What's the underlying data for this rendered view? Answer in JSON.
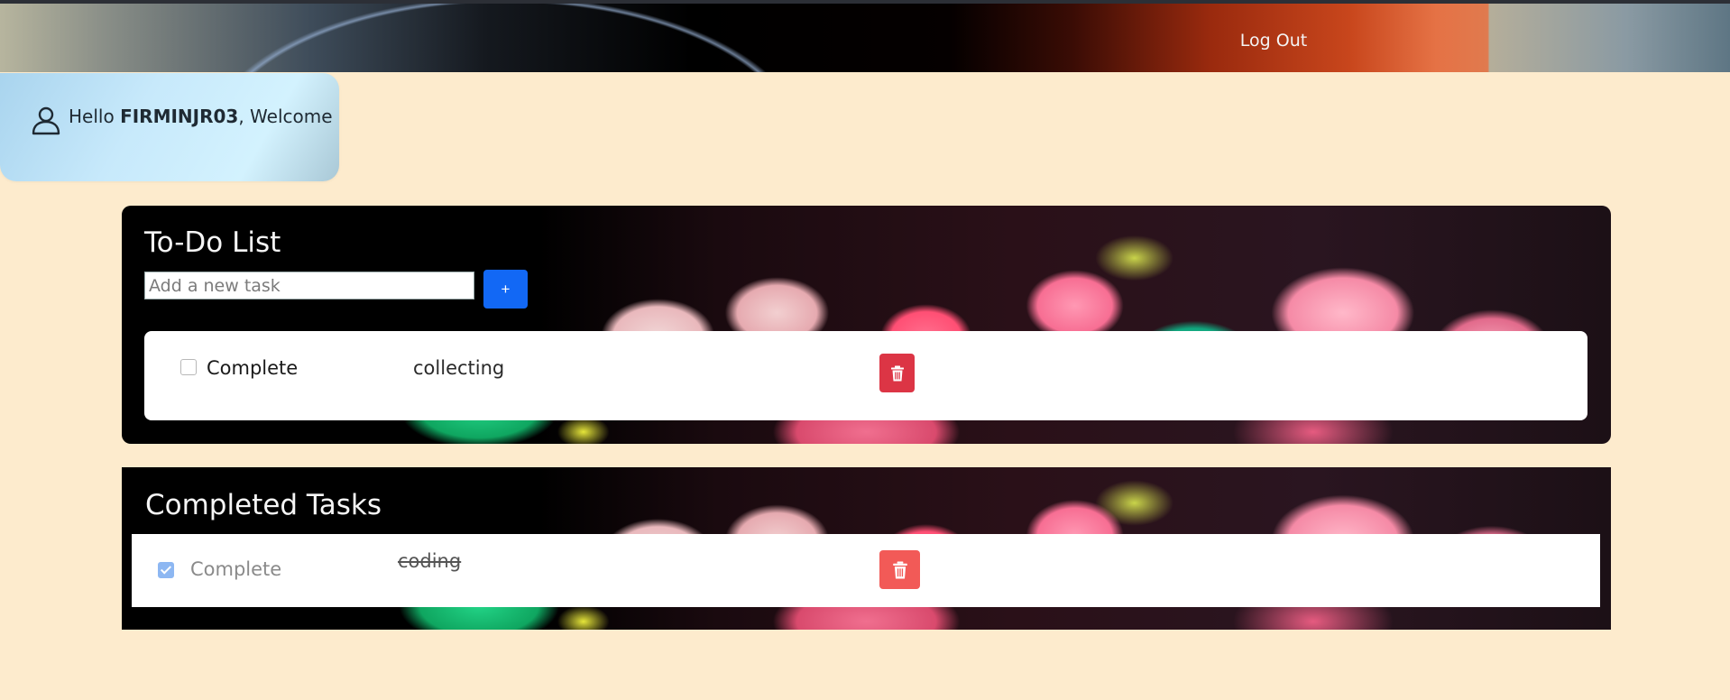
{
  "header": {
    "logout_label": "Log Out"
  },
  "welcome": {
    "hello": "Hello ",
    "username": "FIRMINJR03",
    "suffix": ", Welcome"
  },
  "todo": {
    "title": "To-Do List",
    "input_placeholder": "Add a new task",
    "add_label": "+",
    "tasks": [
      {
        "complete_label": "Complete",
        "text": "collecting",
        "checked": false
      }
    ]
  },
  "completed": {
    "title": "Completed Tasks",
    "tasks": [
      {
        "complete_label": "Complete",
        "text": "coding",
        "checked": true
      }
    ]
  },
  "colors": {
    "page_bg": "#fdebcd",
    "add_button": "#1268f5",
    "delete_button": "#dc3545",
    "delete_button_completed": "#f25a57",
    "checkbox_checked": "#8db7f2"
  },
  "icons": {
    "user": "user-icon",
    "delete": "trash-icon",
    "check": "checkmark-icon"
  }
}
